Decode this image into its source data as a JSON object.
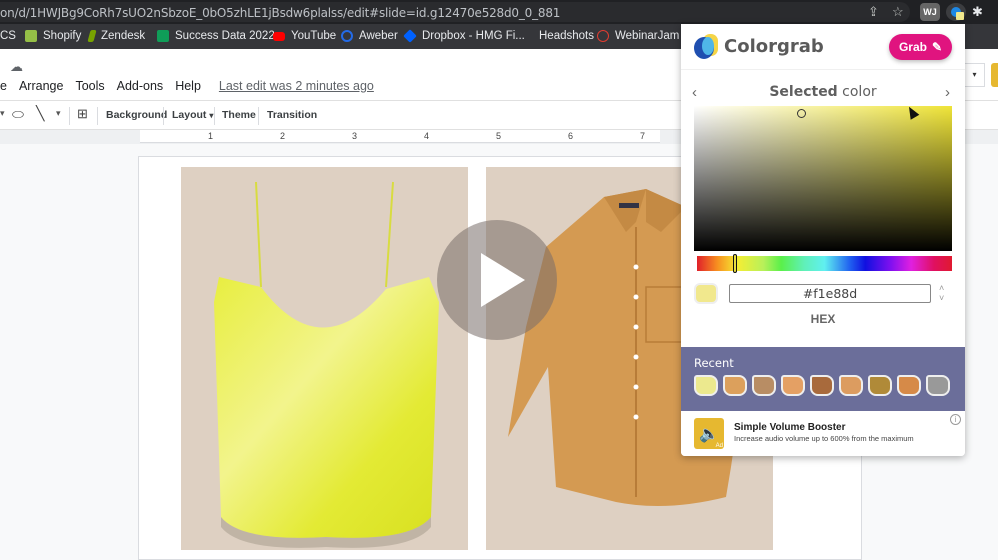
{
  "browser": {
    "url": "on/d/1HWJBg9CoRh7sUO2nSbzoE_0bO5zhLE1jBsdw6plalss/edit#slide=id.g12470e528d0_0_881",
    "icons": [
      "share-icon",
      "star-icon",
      "wj-extension-icon",
      "colorgrab-extension-icon",
      "puzzle-extensions-icon"
    ],
    "wj_label": "WJ",
    "bookmarks": [
      {
        "label": "CS",
        "icon": "none",
        "color": ""
      },
      {
        "label": "Shopify",
        "icon": "shopify-icon",
        "color": "#95bf47"
      },
      {
        "label": "Zendesk",
        "icon": "zendesk-icon",
        "color": "#78a300"
      },
      {
        "label": "Success Data 2022",
        "icon": "sheets-icon",
        "color": "#0f9d58"
      },
      {
        "label": "YouTube",
        "icon": "youtube-icon",
        "color": "#ff0000"
      },
      {
        "label": "Aweber",
        "icon": "aweber-icon",
        "color": "#246be8"
      },
      {
        "label": "Dropbox - HMG Fi...",
        "icon": "dropbox-icon",
        "color": "#0061ff"
      },
      {
        "label": "Headshots",
        "icon": "none",
        "color": ""
      },
      {
        "label": "WebinarJam",
        "icon": "webinarjam-icon",
        "color": "#e03c31"
      }
    ]
  },
  "slides": {
    "menu": [
      "e",
      "Arrange",
      "Tools",
      "Add-ons",
      "Help"
    ],
    "last_edit": "Last edit was 2 minutes ago",
    "toolbar": {
      "background": "Background",
      "layout": "Layout",
      "theme": "Theme",
      "transition": "Transition"
    },
    "ruler": [
      "1",
      "2",
      "3",
      "4",
      "5",
      "6",
      "7"
    ]
  },
  "colorgrab": {
    "title": "Colorgrab",
    "grab_label": "Grab",
    "selected_bold": "Selected",
    "selected_rest": " color",
    "prev_arrow": "‹",
    "next_arrow": "›",
    "hex_value": "#f1e88d",
    "format_label": "HEX",
    "selected_color": "#f1e88d",
    "hue_position": 0.15,
    "recent_label": "Recent",
    "recent_colors": [
      "#ece98e",
      "#dca05c",
      "#b88d64",
      "#e4a064",
      "#a86a3c",
      "#dc9c60",
      "#b08a38",
      "#d68a48",
      "#999999"
    ],
    "ad": {
      "title": "Simple Volume Booster",
      "description": "Increase audio volume up to 600% from the maximum",
      "tag": "Ad",
      "info": "i"
    }
  }
}
